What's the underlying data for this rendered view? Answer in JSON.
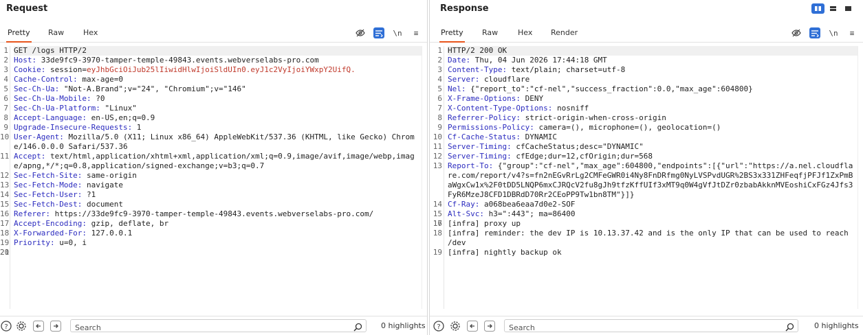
{
  "request": {
    "title": "Request",
    "tabs": [
      "Pretty",
      "Raw",
      "Hex"
    ],
    "active_tab": "Pretty",
    "toolbar": {
      "newline_label": "\\n",
      "menu_label": "≡"
    },
    "lines": [
      {
        "n": "1",
        "text": "GET /logs HTTP/2"
      },
      {
        "n": "2",
        "key": "Host:",
        "val": " 33de9fc9-3970-tamper-temple-49843.events.webverselabs-pro.com"
      },
      {
        "n": "3",
        "key": "Cookie:",
        "val": " session=",
        "val2": "eyJhbGciOiJub25lIiwidHlwIjoiSldUIn0.eyJ1c2VyIjoiYWxpY2UifQ."
      },
      {
        "n": "4",
        "key": "Cache-Control:",
        "val": " max-age=0"
      },
      {
        "n": "5",
        "key": "Sec-Ch-Ua:",
        "val": " \"Not-A.Brand\";v=\"24\", \"Chromium\";v=\"146\""
      },
      {
        "n": "6",
        "key": "Sec-Ch-Ua-Mobile:",
        "val": " ?0"
      },
      {
        "n": "7",
        "key": "Sec-Ch-Ua-Platform:",
        "val": " \"Linux\""
      },
      {
        "n": "8",
        "key": "Accept-Language:",
        "val": " en-US,en;q=0.9"
      },
      {
        "n": "9",
        "key": "Upgrade-Insecure-Requests:",
        "val": " 1"
      },
      {
        "n": "10",
        "key": "User-Agent:",
        "val": " Mozilla/5.0 (X11; Linux x86_64) AppleWebKit/537.36 (KHTML, like Gecko) Chrome/146.0.0.0 Safari/537.36"
      },
      {
        "n": "11",
        "key": "Accept:",
        "val": " text/html,application/xhtml+xml,application/xml;q=0.9,image/avif,image/webp,image/apng,*/*;q=0.8,application/signed-exchange;v=b3;q=0.7"
      },
      {
        "n": "12",
        "key": "Sec-Fetch-Site:",
        "val": " same-origin"
      },
      {
        "n": "13",
        "key": "Sec-Fetch-Mode:",
        "val": " navigate"
      },
      {
        "n": "14",
        "key": "Sec-Fetch-User:",
        "val": " ?1"
      },
      {
        "n": "15",
        "key": "Sec-Fetch-Dest:",
        "val": " document"
      },
      {
        "n": "16",
        "key": "Referer:",
        "val": " https://33de9fc9-3970-tamper-temple-49843.events.webverselabs-pro.com/"
      },
      {
        "n": "17",
        "key": "Accept-Encoding:",
        "val": " gzip, deflate, br"
      },
      {
        "n": "18",
        "key": "X-Forwarded-For:",
        "val": " 127.0.0.1"
      },
      {
        "n": "19",
        "key": "Priority:",
        "val": " u=0, i"
      },
      {
        "n": "20",
        "text": ""
      },
      {
        "n": "21",
        "text": ""
      }
    ],
    "search_placeholder": "Search",
    "highlights": "0 highlights"
  },
  "response": {
    "title": "Response",
    "tabs": [
      "Pretty",
      "Raw",
      "Hex",
      "Render"
    ],
    "active_tab": "Pretty",
    "toolbar": {
      "newline_label": "\\n",
      "menu_label": "≡"
    },
    "lines": [
      {
        "n": "1",
        "text": "HTTP/2 200 OK"
      },
      {
        "n": "2",
        "key": "Date:",
        "val": " Thu, 04 Jun 2026 17:44:18 GMT"
      },
      {
        "n": "3",
        "key": "Content-Type:",
        "val": " text/plain; charset=utf-8"
      },
      {
        "n": "4",
        "key": "Server:",
        "val": " cloudflare"
      },
      {
        "n": "5",
        "key": "Nel:",
        "val": " {\"report_to\":\"cf-nel\",\"success_fraction\":0.0,\"max_age\":604800}"
      },
      {
        "n": "6",
        "key": "X-Frame-Options:",
        "val": " DENY"
      },
      {
        "n": "7",
        "key": "X-Content-Type-Options:",
        "val": " nosniff"
      },
      {
        "n": "8",
        "key": "Referrer-Policy:",
        "val": " strict-origin-when-cross-origin"
      },
      {
        "n": "9",
        "key": "Permissions-Policy:",
        "val": " camera=(), microphone=(), geolocation=()"
      },
      {
        "n": "10",
        "key": "Cf-Cache-Status:",
        "val": " DYNAMIC"
      },
      {
        "n": "11",
        "key": "Server-Timing:",
        "val": " cfCacheStatus;desc=\"DYNAMIC\""
      },
      {
        "n": "12",
        "key": "Server-Timing:",
        "val": " cfEdge;dur=12,cfOrigin;dur=568"
      },
      {
        "n": "13",
        "key": "Report-To:",
        "val": " {\"group\":\"cf-nel\",\"max_age\":604800,\"endpoints\":[{\"url\":\"https://a.nel.cloudflare.com/report/v4?s=fn2nEGvRrLg2CMFeGWR0i4Ny8FnDRfmg0NyLVSPvdUGR%2BS3x331ZHFeqfjPFJf1ZxPmBaWgxCw1x%2F0tDD5LNQP6mxCJRQcV2fu8gJh9tfzKffUIf3xMT9q0W4gVfJtDZr0zbabAkknMVEoshiCxFGz4Jfs3FyR6MzeJ8CFD1DBRdD70Rr2CEoPP9Tw1bn8TM\"}]}"
      },
      {
        "n": "14",
        "key": "Cf-Ray:",
        "val": " a068bea6eaa7d0e2-SOF"
      },
      {
        "n": "15",
        "key": "Alt-Svc:",
        "val": " h3=\":443\"; ma=86400"
      },
      {
        "n": "16",
        "text": ""
      },
      {
        "n": "17",
        "text": "[infra] proxy up"
      },
      {
        "n": "18",
        "text": "[infra] reminder: the dev IP is 10.13.37.42 and is the only IP that can be used to reach /dev"
      },
      {
        "n": "19",
        "text": "[infra] nightly backup ok"
      }
    ],
    "search_placeholder": "Search",
    "highlights": "0 highlights"
  },
  "colors": {
    "accent_tab": "#e8541c",
    "selected_icon": "#2f6fd6",
    "header_key": "#2b2bbf",
    "cookie_value": "#c0392b"
  }
}
